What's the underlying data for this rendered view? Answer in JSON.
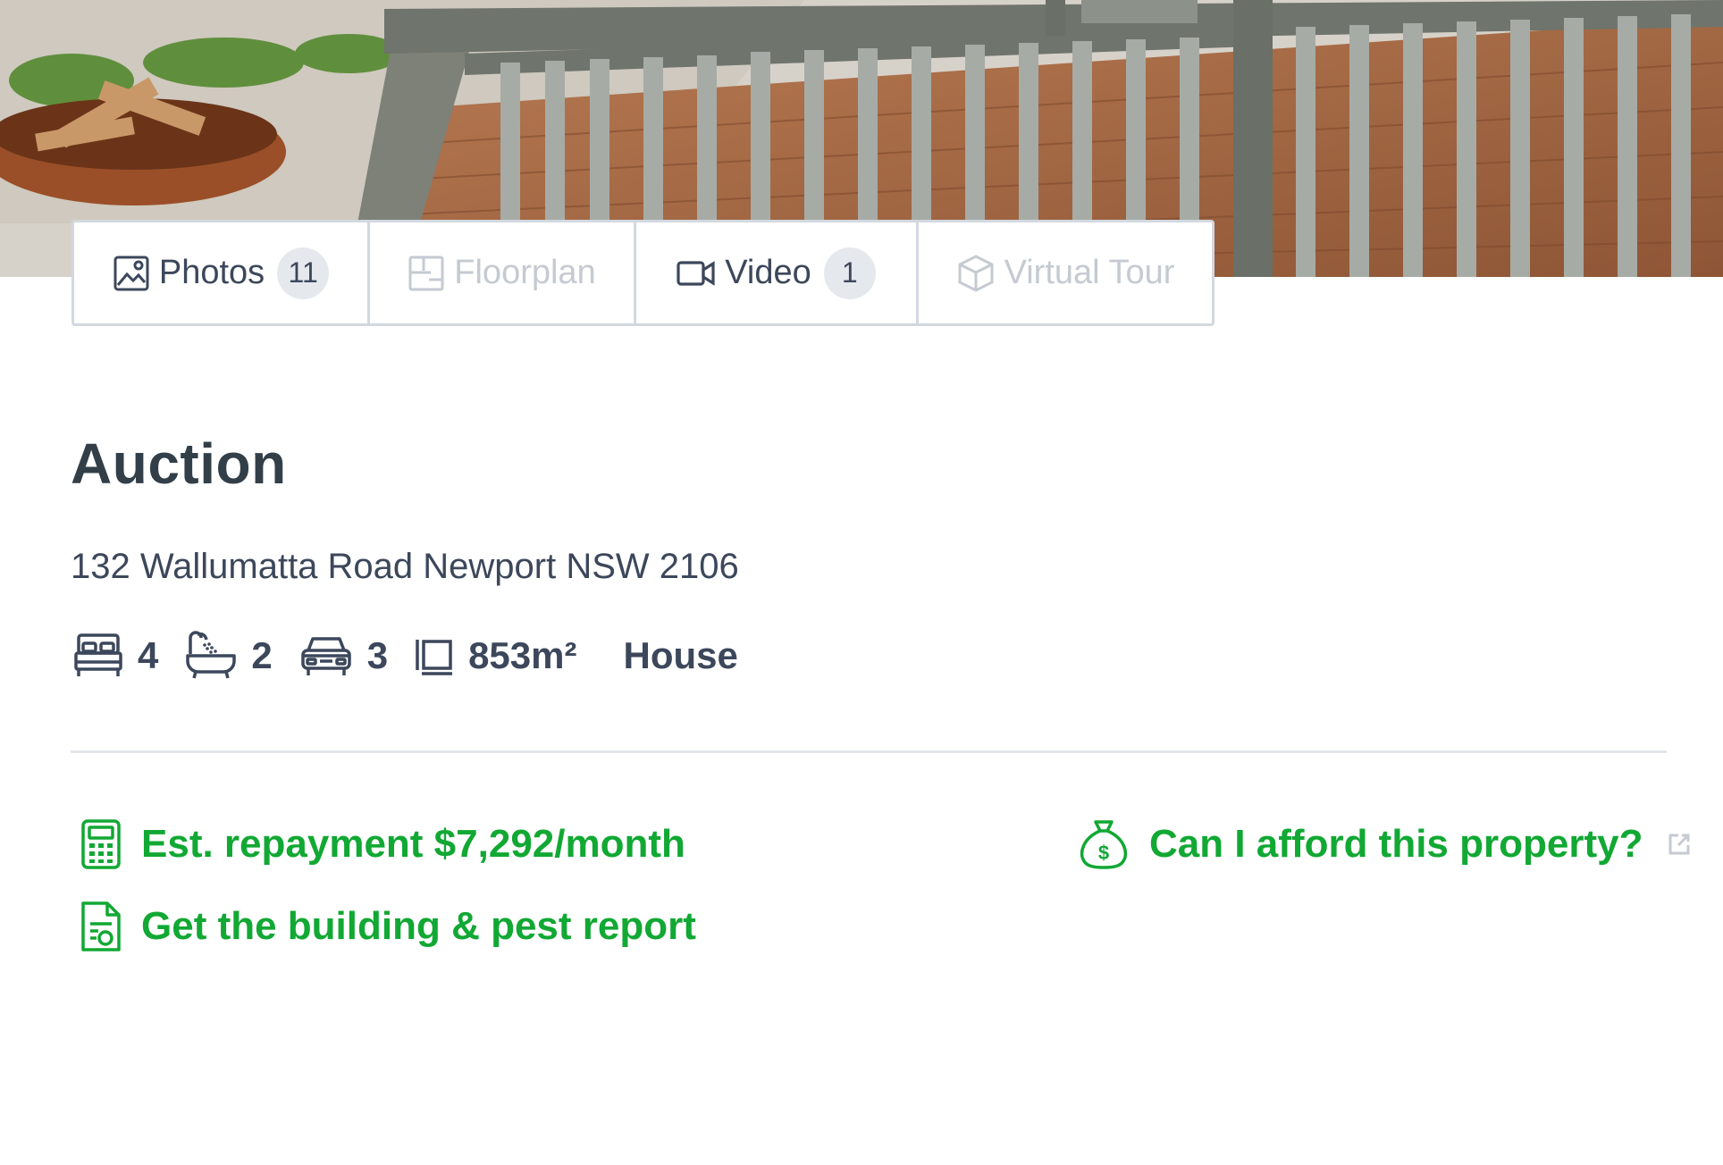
{
  "media_tabs": [
    {
      "id": "photos",
      "label": "Photos",
      "count": "11",
      "icon": "photo-icon",
      "enabled": true
    },
    {
      "id": "floorplan",
      "label": "Floorplan",
      "icon": "floorplan-icon",
      "enabled": false
    },
    {
      "id": "video",
      "label": "Video",
      "count": "1",
      "icon": "video-camera-icon",
      "enabled": true
    },
    {
      "id": "virtual-tour",
      "label": "Virtual Tour",
      "icon": "cube-icon",
      "enabled": false
    }
  ],
  "listing": {
    "price": "Auction",
    "address": "132 Wallumatta Road Newport NSW 2106",
    "features": {
      "beds": "4",
      "baths": "2",
      "parking": "3",
      "land": "853m²",
      "type": "House"
    }
  },
  "links": {
    "repayment": "Est. repayment $7,292/month",
    "report": "Get the building & pest report",
    "afford": "Can I afford this property?"
  },
  "colors": {
    "accent_green": "#11a833",
    "text": "#3c475b",
    "disabled": "#c5cad2",
    "border": "#d3d8e0"
  }
}
